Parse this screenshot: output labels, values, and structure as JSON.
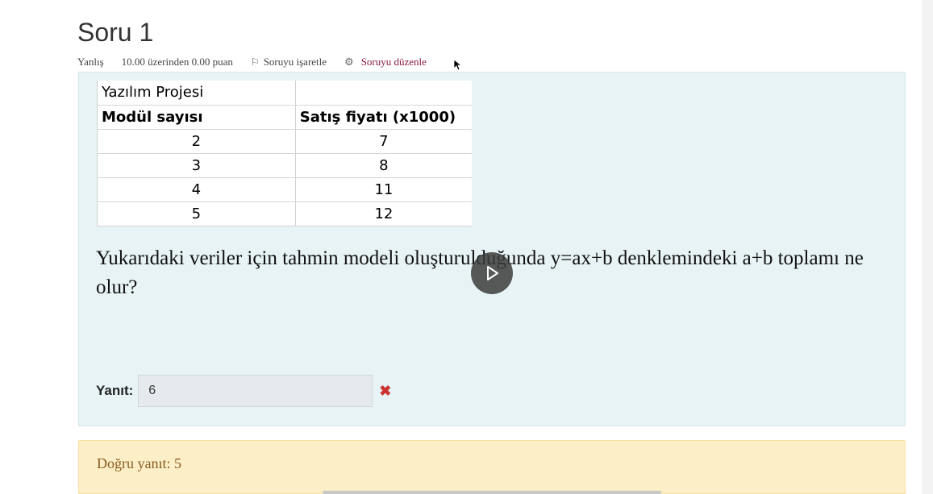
{
  "question": {
    "title": "Soru 1",
    "state": "Yanlış",
    "grade": "10.00 üzerinden 0.00 puan",
    "flag_label": "Soruyu işaretle",
    "edit_label": "Soruyu düzenle"
  },
  "table": {
    "title": "Yazılım Projesi",
    "headers": [
      "Modül sayısı",
      "Satış fiyatı (x1000)"
    ],
    "rows": [
      [
        "2",
        "7"
      ],
      [
        "3",
        "8"
      ],
      [
        "4",
        "11"
      ],
      [
        "5",
        "12"
      ]
    ]
  },
  "question_text": "Yukarıdaki veriler için tahmin modeli oluşturulduğunda y=ax+b denklemindeki a+b toplamı ne olur?",
  "answer": {
    "label": "Yanıt:",
    "value": "6"
  },
  "feedback": {
    "right_answer": "Doğru yanıt: 5"
  },
  "icons": {
    "flag": "flag-icon",
    "edit": "gear-icon",
    "incorrect": "cross-icon",
    "video": "play-icon"
  },
  "colors": {
    "formulation_bg": "#e7f3f5",
    "outcome_bg": "#fcefc7",
    "edit_link": "#8b1c3c",
    "incorrect_mark": "#cc3333"
  }
}
